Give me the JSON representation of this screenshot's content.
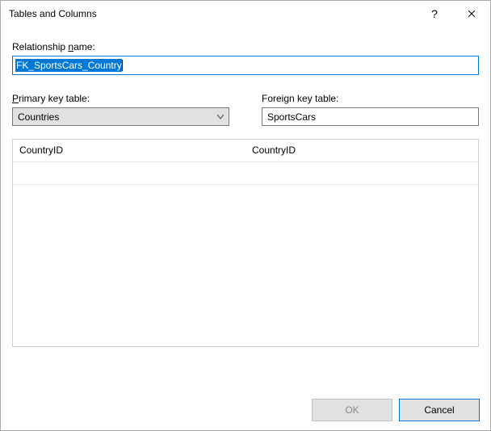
{
  "window": {
    "title": "Tables and Columns",
    "help_symbol": "?",
    "close_symbol": "✕"
  },
  "labels": {
    "relationship_name_pre": "Relationship ",
    "relationship_name_u": "n",
    "relationship_name_post": "ame:",
    "primary_key_u": "P",
    "primary_key_post": "rimary key table:",
    "foreign_key": "Foreign key table:"
  },
  "fields": {
    "relationship_name_value": "FK_SportsCars_Country",
    "primary_key_table": "Countries",
    "foreign_key_table": "SportsCars"
  },
  "columns": {
    "primary": [
      "CountryID"
    ],
    "foreign": [
      "CountryID"
    ]
  },
  "buttons": {
    "ok": "OK",
    "cancel": "Cancel"
  }
}
